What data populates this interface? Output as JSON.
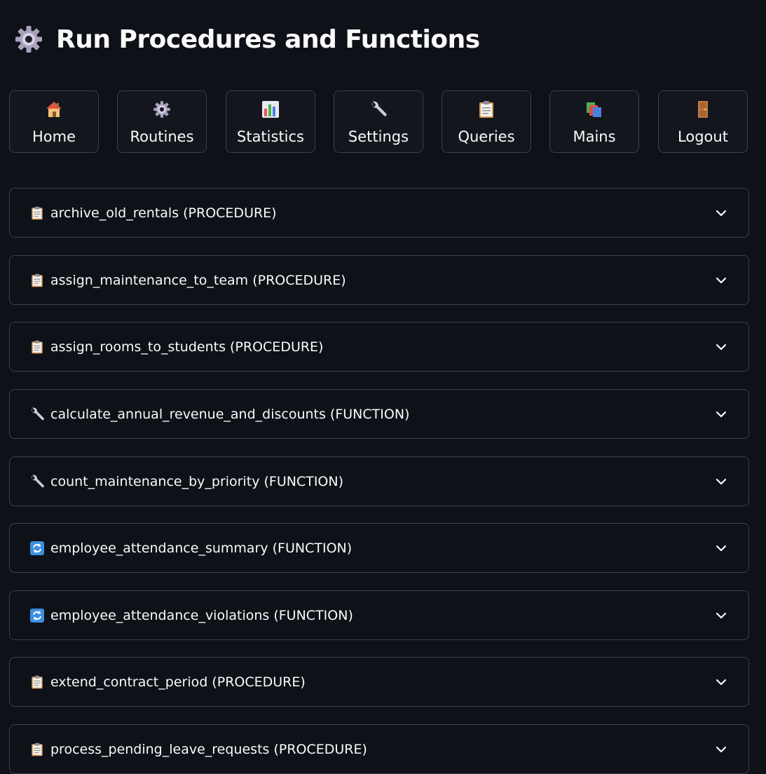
{
  "page": {
    "title": "Run Procedures and Functions",
    "title_icon": "gear-icon"
  },
  "nav": [
    {
      "label": "Home",
      "icon": "house-icon"
    },
    {
      "label": "Routines",
      "icon": "gear-icon"
    },
    {
      "label": "Statistics",
      "icon": "bar-chart-icon"
    },
    {
      "label": "Settings",
      "icon": "wrench-icon"
    },
    {
      "label": "Queries",
      "icon": "clipboard-icon"
    },
    {
      "label": "Mains",
      "icon": "books-icon"
    },
    {
      "label": "Logout",
      "icon": "door-icon"
    }
  ],
  "routines": [
    {
      "label": "archive_old_rentals (PROCEDURE)",
      "icon": "clipboard-icon"
    },
    {
      "label": "assign_maintenance_to_team (PROCEDURE)",
      "icon": "clipboard-icon"
    },
    {
      "label": "assign_rooms_to_students (PROCEDURE)",
      "icon": "clipboard-icon"
    },
    {
      "label": "calculate_annual_revenue_and_discounts (FUNCTION)",
      "icon": "wrench-icon"
    },
    {
      "label": "count_maintenance_by_priority (FUNCTION)",
      "icon": "wrench-icon"
    },
    {
      "label": "employee_attendance_summary (FUNCTION)",
      "icon": "refresh-icon"
    },
    {
      "label": "employee_attendance_violations (FUNCTION)",
      "icon": "refresh-icon"
    },
    {
      "label": "extend_contract_period (PROCEDURE)",
      "icon": "clipboard-icon"
    },
    {
      "label": "process_pending_leave_requests (PROCEDURE)",
      "icon": "clipboard-icon"
    }
  ],
  "colors": {
    "background": "#0e1117",
    "border": "#3d4048",
    "text": "#fafafa"
  }
}
